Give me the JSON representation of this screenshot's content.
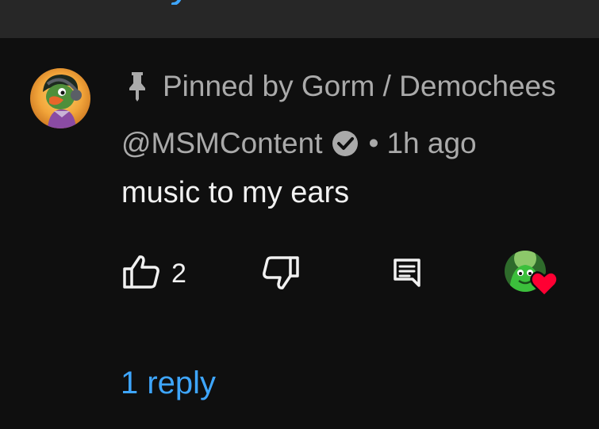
{
  "comment": {
    "pinned_text": "Pinned by Gorm / Demochees",
    "author_handle": "@MSMContent",
    "separator": "•",
    "timestamp": "1h ago",
    "text": "music to my ears",
    "like_count": "2",
    "replies_label": "1 reply"
  },
  "colors": {
    "background": "#0f0f0f",
    "top_strip": "#272727",
    "secondary_text": "#aaaaaa",
    "primary_text": "#f1f1f1",
    "link": "#3ea6ff",
    "heart": "#ff0033"
  },
  "icons": {
    "pin": "pin-icon",
    "verified": "verified-check-icon",
    "like": "thumbs-up-icon",
    "dislike": "thumbs-down-icon",
    "reply": "comment-reply-icon",
    "creator_heart": "heart-icon"
  }
}
